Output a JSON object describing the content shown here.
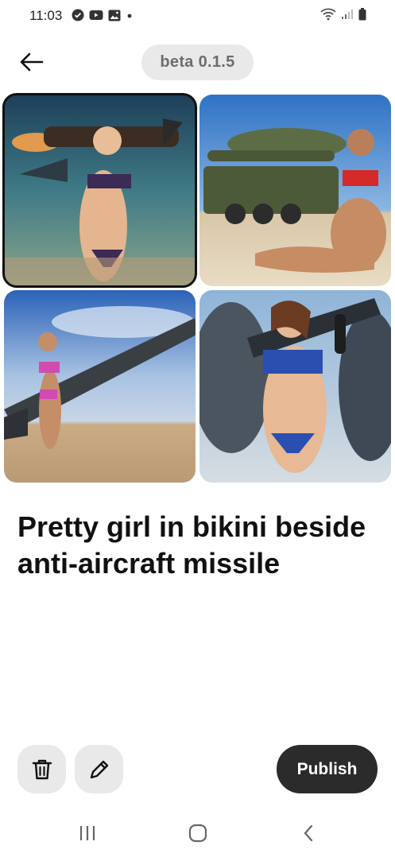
{
  "status_bar": {
    "time": "11:03"
  },
  "header": {
    "version": "beta 0.1.5"
  },
  "images": [
    {
      "name": "image-1",
      "selected": true
    },
    {
      "name": "image-2",
      "selected": false
    },
    {
      "name": "image-3",
      "selected": false
    },
    {
      "name": "image-4",
      "selected": false
    }
  ],
  "prompt": {
    "title": "Pretty girl in bikini beside anti-aircraft missile"
  },
  "actions": {
    "publish_label": "Publish"
  }
}
